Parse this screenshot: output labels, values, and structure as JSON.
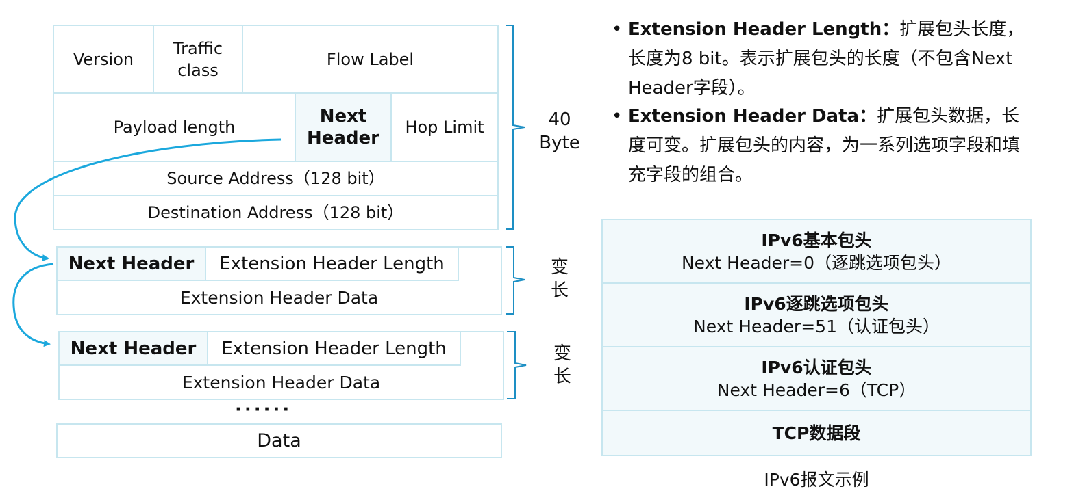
{
  "base_header": {
    "version": "Version",
    "traffic_class": "Traffic class",
    "flow_label": "Flow Label",
    "payload_length": "Payload length",
    "next_header": "Next Header",
    "hop_limit": "Hop Limit",
    "source_address": "Source Address（128 bit）",
    "destination_address": "Destination Address（128 bit）",
    "size_label": "40 Byte"
  },
  "ext_header_1": {
    "next_header": "Next Header",
    "ext_length": "Extension Header Length",
    "ext_data": "Extension Header Data",
    "size_label": "变长"
  },
  "ext_header_2": {
    "next_header": "Next Header",
    "ext_length": "Extension Header Length",
    "ext_data": "Extension Header Data",
    "size_label": "变长"
  },
  "ellipsis": "······",
  "data_label": "Data",
  "bullets": [
    {
      "term": "Extension Header Length：",
      "text": "扩展包头长度，长度为8 bit。表示扩展包头的长度（不包含Next Header字段）。"
    },
    {
      "term": "Extension Header Data：",
      "text": "扩展包头数据，长度可变。扩展包头的内容，为一系列选项字段和填充字段的组合。"
    }
  ],
  "example_stack": [
    {
      "title": "IPv6基本包头",
      "subtitle": "Next Header=0（逐跳选项包头）"
    },
    {
      "title": "IPv6逐跳选项包头",
      "subtitle": "Next Header=51（认证包头）"
    },
    {
      "title": "IPv6认证包头",
      "subtitle": "Next Header=6（TCP）"
    },
    {
      "title": "TCP数据段",
      "subtitle": ""
    }
  ],
  "example_caption": "IPv6报文示例",
  "colors": {
    "border": "#c7e6ef",
    "shade": "#f2f9fb",
    "arrow": "#1ba8dd",
    "brace": "#1d8fc4"
  }
}
